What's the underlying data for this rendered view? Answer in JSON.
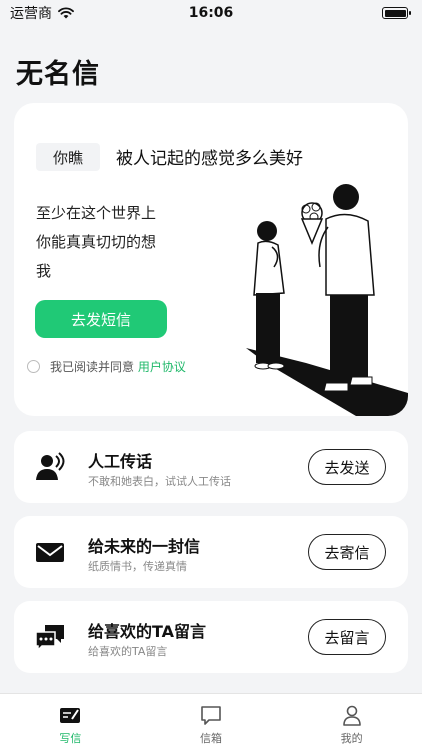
{
  "status_bar": {
    "carrier": "运营商",
    "time": "16:06"
  },
  "page_title": "无名信",
  "hero": {
    "tag": "你瞧",
    "headline": "被人记起的感觉多么美好",
    "body_lines": [
      "至少在这个世界上",
      "你能真真切切的想",
      "我"
    ],
    "cta_label": "去发短信",
    "agreement_text": "我已阅读并同意",
    "agreement_link": "用户协议"
  },
  "cards": [
    {
      "title": "人工传话",
      "subtitle": "不敢和她表白，试试人工传话",
      "button": "去发送",
      "icon": "person-voice-icon"
    },
    {
      "title": "给未来的一封信",
      "subtitle": "纸质情书，传递真情",
      "button": "去寄信",
      "icon": "envelope-icon"
    },
    {
      "title": "给喜欢的TA留言",
      "subtitle": "给喜欢的TA留言",
      "button": "去留言",
      "icon": "chat-bubbles-icon"
    }
  ],
  "tabbar": [
    {
      "label": "写信",
      "icon": "write-letter-icon",
      "active": true
    },
    {
      "label": "信箱",
      "icon": "message-box-icon",
      "active": false
    },
    {
      "label": "我的",
      "icon": "profile-icon",
      "active": false
    }
  ],
  "colors": {
    "accent": "#20c976",
    "background": "#f3f4f6",
    "card": "#ffffff"
  }
}
